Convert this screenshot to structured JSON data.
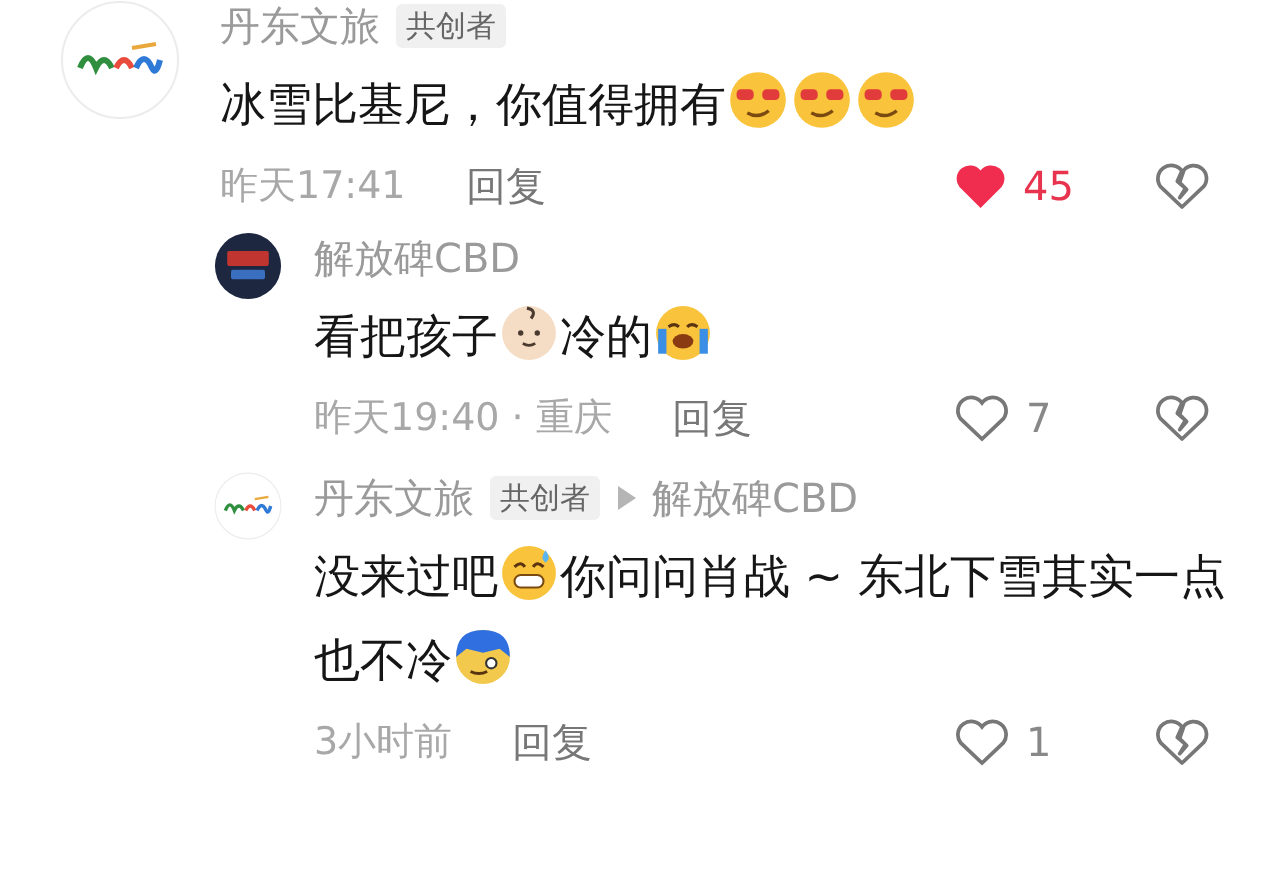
{
  "comments": [
    {
      "avatar": {
        "kind": "logo"
      },
      "author": "丹东文旅",
      "badge": "共创者",
      "segments": [
        {
          "kind": "text",
          "text": "冰雪比基尼，你值得拥有"
        },
        {
          "kind": "glasses"
        },
        {
          "kind": "glasses"
        },
        {
          "kind": "glasses"
        }
      ],
      "meta": "昨天17:41",
      "reply": "回复",
      "likes": "45",
      "liked": true,
      "children": [
        {
          "avatar": {
            "kind": "dark"
          },
          "author": "解放碑CBD",
          "segments": [
            {
              "kind": "text",
              "text": "看把孩子"
            },
            {
              "kind": "baby"
            },
            {
              "kind": "text",
              "text": "冷的"
            },
            {
              "kind": "crying"
            }
          ],
          "meta": "昨天19:40 · 重庆",
          "reply": "回复",
          "likes": "7",
          "liked": false
        },
        {
          "avatar": {
            "kind": "logo"
          },
          "author": "丹东文旅",
          "badge": "共创者",
          "reply_to": "解放碑CBD",
          "segments": [
            {
              "kind": "text",
              "text": "没来过吧"
            },
            {
              "kind": "sweat"
            },
            {
              "kind": "text",
              "text": "你问问肖战 ~ 东北下雪其实一点也不冷"
            },
            {
              "kind": "freezing"
            }
          ],
          "meta": "3小时前",
          "reply": "回复",
          "likes": "1",
          "liked": false
        }
      ]
    }
  ]
}
